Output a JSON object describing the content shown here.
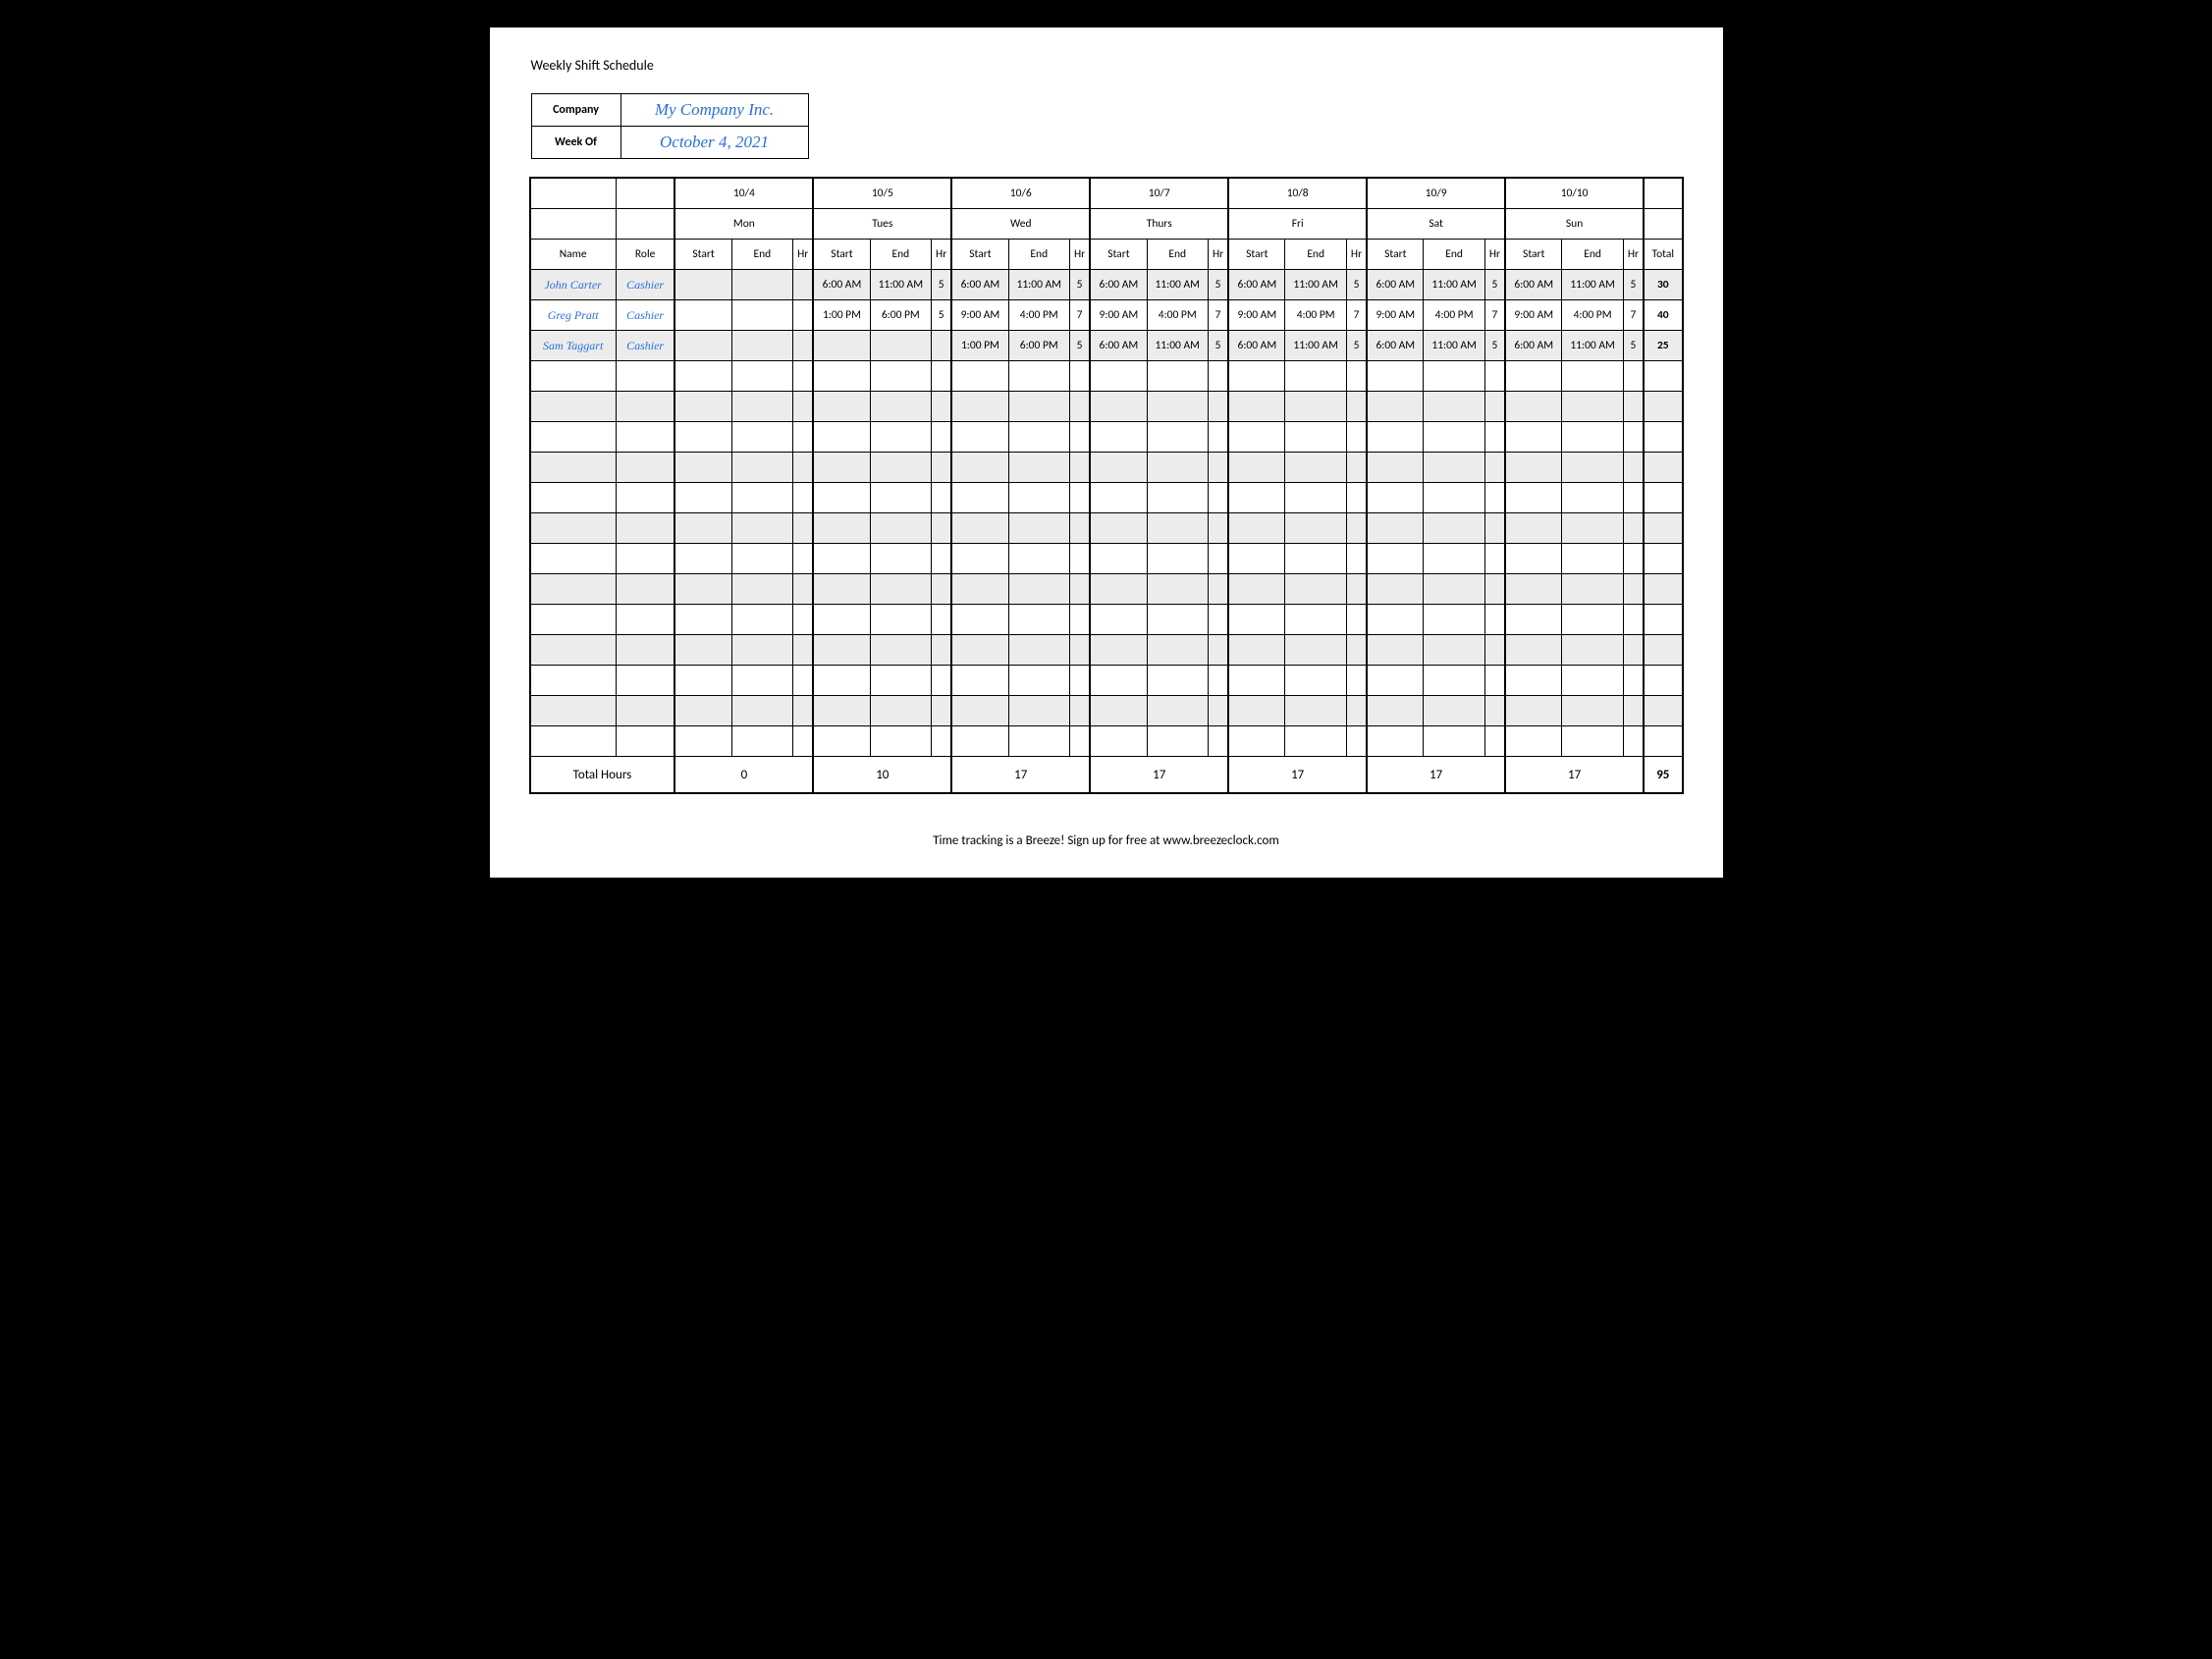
{
  "title": "Weekly Shift Schedule",
  "meta": {
    "company_label": "Company",
    "company_value": "My Company Inc.",
    "week_label": "Week Of",
    "week_value": "October 4, 2021"
  },
  "days": [
    {
      "date": "10/4",
      "dow": "Mon"
    },
    {
      "date": "10/5",
      "dow": "Tues"
    },
    {
      "date": "10/6",
      "dow": "Wed"
    },
    {
      "date": "10/7",
      "dow": "Thurs"
    },
    {
      "date": "10/8",
      "dow": "Fri"
    },
    {
      "date": "10/9",
      "dow": "Sat"
    },
    {
      "date": "10/10",
      "dow": "Sun"
    }
  ],
  "columns": {
    "name": "Name",
    "role": "Role",
    "start": "Start",
    "end": "End",
    "hr": "Hr",
    "total": "Total"
  },
  "rows": [
    {
      "name": "John Carter",
      "role": "Cashier",
      "shifts": [
        {
          "start": "",
          "end": "",
          "hr": ""
        },
        {
          "start": "6:00 AM",
          "end": "11:00 AM",
          "hr": "5"
        },
        {
          "start": "6:00 AM",
          "end": "11:00 AM",
          "hr": "5"
        },
        {
          "start": "6:00 AM",
          "end": "11:00 AM",
          "hr": "5"
        },
        {
          "start": "6:00 AM",
          "end": "11:00 AM",
          "hr": "5"
        },
        {
          "start": "6:00 AM",
          "end": "11:00 AM",
          "hr": "5"
        },
        {
          "start": "6:00 AM",
          "end": "11:00 AM",
          "hr": "5"
        }
      ],
      "total": "30"
    },
    {
      "name": "Greg Pratt",
      "role": "Cashier",
      "shifts": [
        {
          "start": "",
          "end": "",
          "hr": ""
        },
        {
          "start": "1:00 PM",
          "end": "6:00 PM",
          "hr": "5"
        },
        {
          "start": "9:00 AM",
          "end": "4:00 PM",
          "hr": "7"
        },
        {
          "start": "9:00 AM",
          "end": "4:00 PM",
          "hr": "7"
        },
        {
          "start": "9:00 AM",
          "end": "4:00 PM",
          "hr": "7"
        },
        {
          "start": "9:00 AM",
          "end": "4:00 PM",
          "hr": "7"
        },
        {
          "start": "9:00 AM",
          "end": "4:00 PM",
          "hr": "7"
        }
      ],
      "total": "40"
    },
    {
      "name": "Sam Taggart",
      "role": "Cashier",
      "shifts": [
        {
          "start": "",
          "end": "",
          "hr": ""
        },
        {
          "start": "",
          "end": "",
          "hr": ""
        },
        {
          "start": "1:00 PM",
          "end": "6:00 PM",
          "hr": "5"
        },
        {
          "start": "6:00 AM",
          "end": "11:00 AM",
          "hr": "5"
        },
        {
          "start": "6:00 AM",
          "end": "11:00 AM",
          "hr": "5"
        },
        {
          "start": "6:00 AM",
          "end": "11:00 AM",
          "hr": "5"
        },
        {
          "start": "6:00 AM",
          "end": "11:00 AM",
          "hr": "5"
        }
      ],
      "total": "25"
    }
  ],
  "empty_rows": 13,
  "footer": {
    "total_hours_label": "Total Hours",
    "day_totals": [
      "0",
      "10",
      "17",
      "17",
      "17",
      "17",
      "17"
    ],
    "grand_total": "95"
  },
  "footnote": "Time tracking is a Breeze! Sign up for free at www.breezeclock.com"
}
